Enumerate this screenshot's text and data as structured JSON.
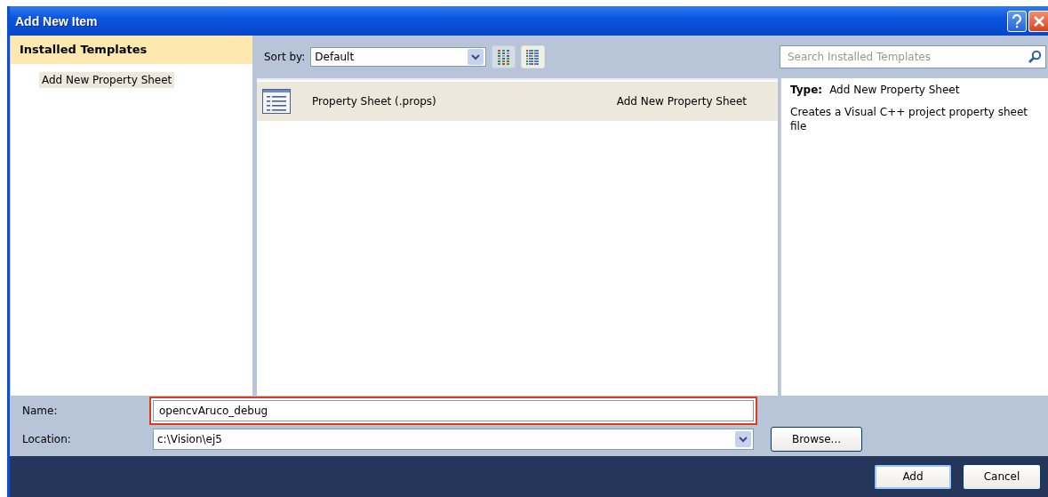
{
  "window": {
    "title": "Add New Item"
  },
  "sidebar": {
    "header": "Installed Templates",
    "items": [
      {
        "label": "Add New Property Sheet",
        "selected": true
      }
    ]
  },
  "toolbar": {
    "sort_label": "Sort by:",
    "sort_value": "Default",
    "views": [
      {
        "kind": "medium",
        "selected": false
      },
      {
        "kind": "small",
        "selected": true
      }
    ],
    "search": {
      "placeholder": "Search Installed Templates"
    }
  },
  "templates": [
    {
      "name": "Property Sheet (.props)",
      "type": "Add New Property Sheet",
      "selected": true
    }
  ],
  "details": {
    "type_label": "Type:",
    "type_value": "Add New Property Sheet",
    "description": "Creates a Visual C++ project property sheet file"
  },
  "form": {
    "name": {
      "label": "Name:",
      "value": "opencvAruco_debug",
      "highlighted": true
    },
    "location": {
      "label": "Location:",
      "value": "c:\\Vision\\ej5"
    },
    "browse": "Browse..."
  },
  "buttons": [
    {
      "label": "Add",
      "default": true
    },
    {
      "label": "Cancel",
      "default": false
    }
  ]
}
